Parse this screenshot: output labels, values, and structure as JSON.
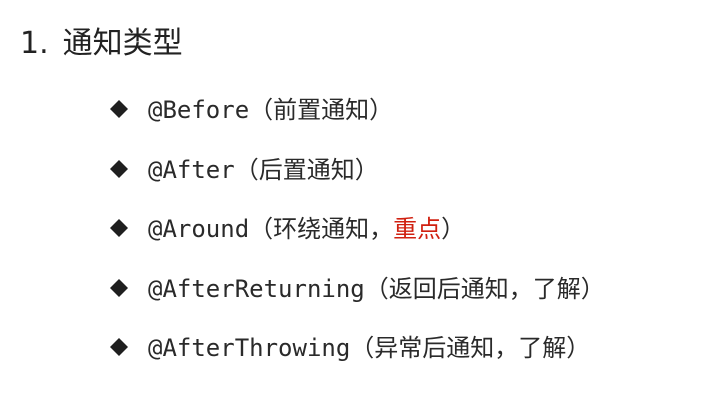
{
  "heading": {
    "number": "1.",
    "title": "通知类型"
  },
  "items": [
    {
      "annotation": "@Before",
      "open": "（",
      "desc": "前置通知",
      "emphasis": "",
      "close": "）"
    },
    {
      "annotation": "@After",
      "open": "（",
      "desc": "后置通知",
      "emphasis": "",
      "close": "）"
    },
    {
      "annotation": "@Around",
      "open": "（",
      "desc": "环绕通知，",
      "emphasis": "重点",
      "close": "）"
    },
    {
      "annotation": "@AfterReturning",
      "open": "（",
      "desc": "返回后通知，了解",
      "emphasis": "",
      "close": "）"
    },
    {
      "annotation": "@AfterThrowing",
      "open": "（",
      "desc": "异常后通知，了解",
      "emphasis": "",
      "close": "）"
    }
  ],
  "colors": {
    "text": "#2a2a2a",
    "emphasis": "#d02010",
    "bullet": "#1f1f1f"
  },
  "bullet_icon": "diamond-icon"
}
